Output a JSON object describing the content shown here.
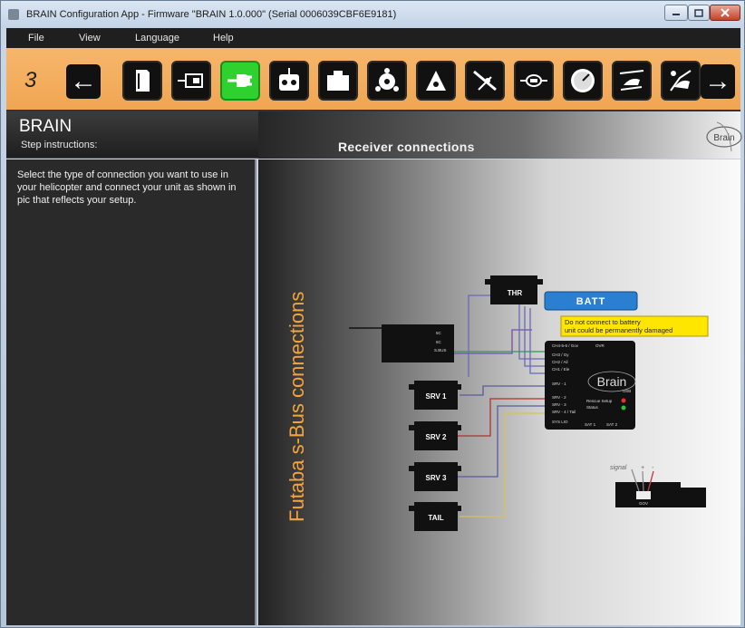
{
  "window": {
    "title": "BRAIN Configuration App - Firmware \"BRAIN 1.0.000\" (Serial 0006039CBF6E9181)"
  },
  "menu": {
    "file": "File",
    "view": "View",
    "language": "Language",
    "help": "Help"
  },
  "toolbar": {
    "step_number": "3",
    "back_glyph": "←",
    "next_glyph": "→",
    "steps": [
      {
        "icon": "document-icon"
      },
      {
        "icon": "unit-orientation-icon"
      },
      {
        "icon": "plug-icon",
        "active": true
      },
      {
        "icon": "transmitter-icon"
      },
      {
        "icon": "box-icon"
      },
      {
        "icon": "swashplate-icon"
      },
      {
        "icon": "collective-icon"
      },
      {
        "icon": "tail-rotor-icon"
      },
      {
        "icon": "governor-icon"
      },
      {
        "icon": "gauge-icon"
      },
      {
        "icon": "helicopter-flight-icon"
      },
      {
        "icon": "helicopter-advanced-icon"
      }
    ]
  },
  "header": {
    "app_name": "BRAIN",
    "step_instructions_label": "Step instructions:",
    "section_title": "Receiver connections",
    "logo_text": "Brain"
  },
  "instructions": "Select the type of connection you want to use in your helicopter and connect your unit as shown in pic that reflects your setup.",
  "diagram": {
    "vertical_title": "Futaba s-Bus connections",
    "thr_label": "THR",
    "batt_label": "BATT",
    "warning_line1": "Do not connect to battery",
    "warning_line2": "unit could be permanently damaged",
    "servo_labels": [
      "SRV 1",
      "SRV 2",
      "SRV 3",
      "TAIL"
    ],
    "brain_unit_label": "Brain",
    "ch_labels": [
      "CH4-5-6 / Gov",
      "CH3 / Gy",
      "CH2 / Ail",
      "CH1 / Ele",
      "SRV - 1",
      "SRV - 2",
      "SRV - 3",
      "SRV - 4 / Tail"
    ],
    "unit_ovr": "OVR",
    "unit_usb": "USB",
    "unit_status": [
      "Rescue Setup",
      "Status"
    ],
    "unit_bottom": [
      "SAT 1",
      "SAT 2"
    ],
    "unit_bottom_left": "SYS LIO",
    "receiver_port_label": "S.BUS",
    "receiver_pins": [
      "5C",
      "6C"
    ],
    "connector_labels": [
      "signal",
      "+",
      "-"
    ],
    "connector_gov": "GOV",
    "colors": {
      "wire_green": "#2c9b55",
      "wire_purple": "#5a5a9a",
      "wire_red": "#b03030",
      "wire_yellow": "#d6c25a",
      "accent_orange": "#f5a43b",
      "batt_blue": "#2a7fd0",
      "warning_yellow": "#ffe600"
    }
  }
}
